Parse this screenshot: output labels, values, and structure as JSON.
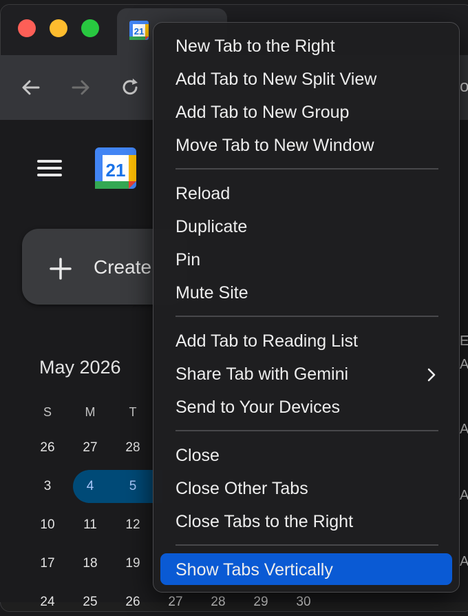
{
  "browser": {
    "tab": {
      "favicon": "google-calendar-icon",
      "favicon_number": "21"
    },
    "toolbar": {
      "back": "arrow-left-icon",
      "forward": "arrow-right-icon",
      "reload": "reload-icon",
      "right_peek": "o"
    }
  },
  "calendar": {
    "logo_number": "21",
    "create_label": "Create",
    "month_title": "May 2026",
    "weekday_headers": [
      "S",
      "M",
      "T"
    ],
    "weeks": [
      [
        "26",
        "27",
        "28"
      ],
      [
        "3",
        "4",
        "5"
      ],
      [
        "10",
        "11",
        "12"
      ],
      [
        "17",
        "18",
        "19"
      ],
      [
        "24",
        "25",
        "26",
        "27",
        "28",
        "29",
        "30"
      ]
    ],
    "selected": [
      "4",
      "5"
    ],
    "right_edge_letters": [
      "E",
      "A",
      "A",
      "A",
      "A"
    ]
  },
  "context_menu": {
    "items": [
      "New Tab to the Right",
      "Add Tab to New Split View",
      "Add Tab to New Group",
      "Move Tab to New Window",
      "Reload",
      "Duplicate",
      "Pin",
      "Mute Site",
      "Add Tab to Reading List",
      "Share Tab with Gemini",
      "Send to Your Devices",
      "Close",
      "Close Other Tabs",
      "Close Tabs to the Right",
      "Show Tabs Vertically"
    ],
    "highlighted": "Show Tabs Vertically",
    "submenu_icon": "chevron-right-icon",
    "highlight_color": "#0a5ad4"
  }
}
